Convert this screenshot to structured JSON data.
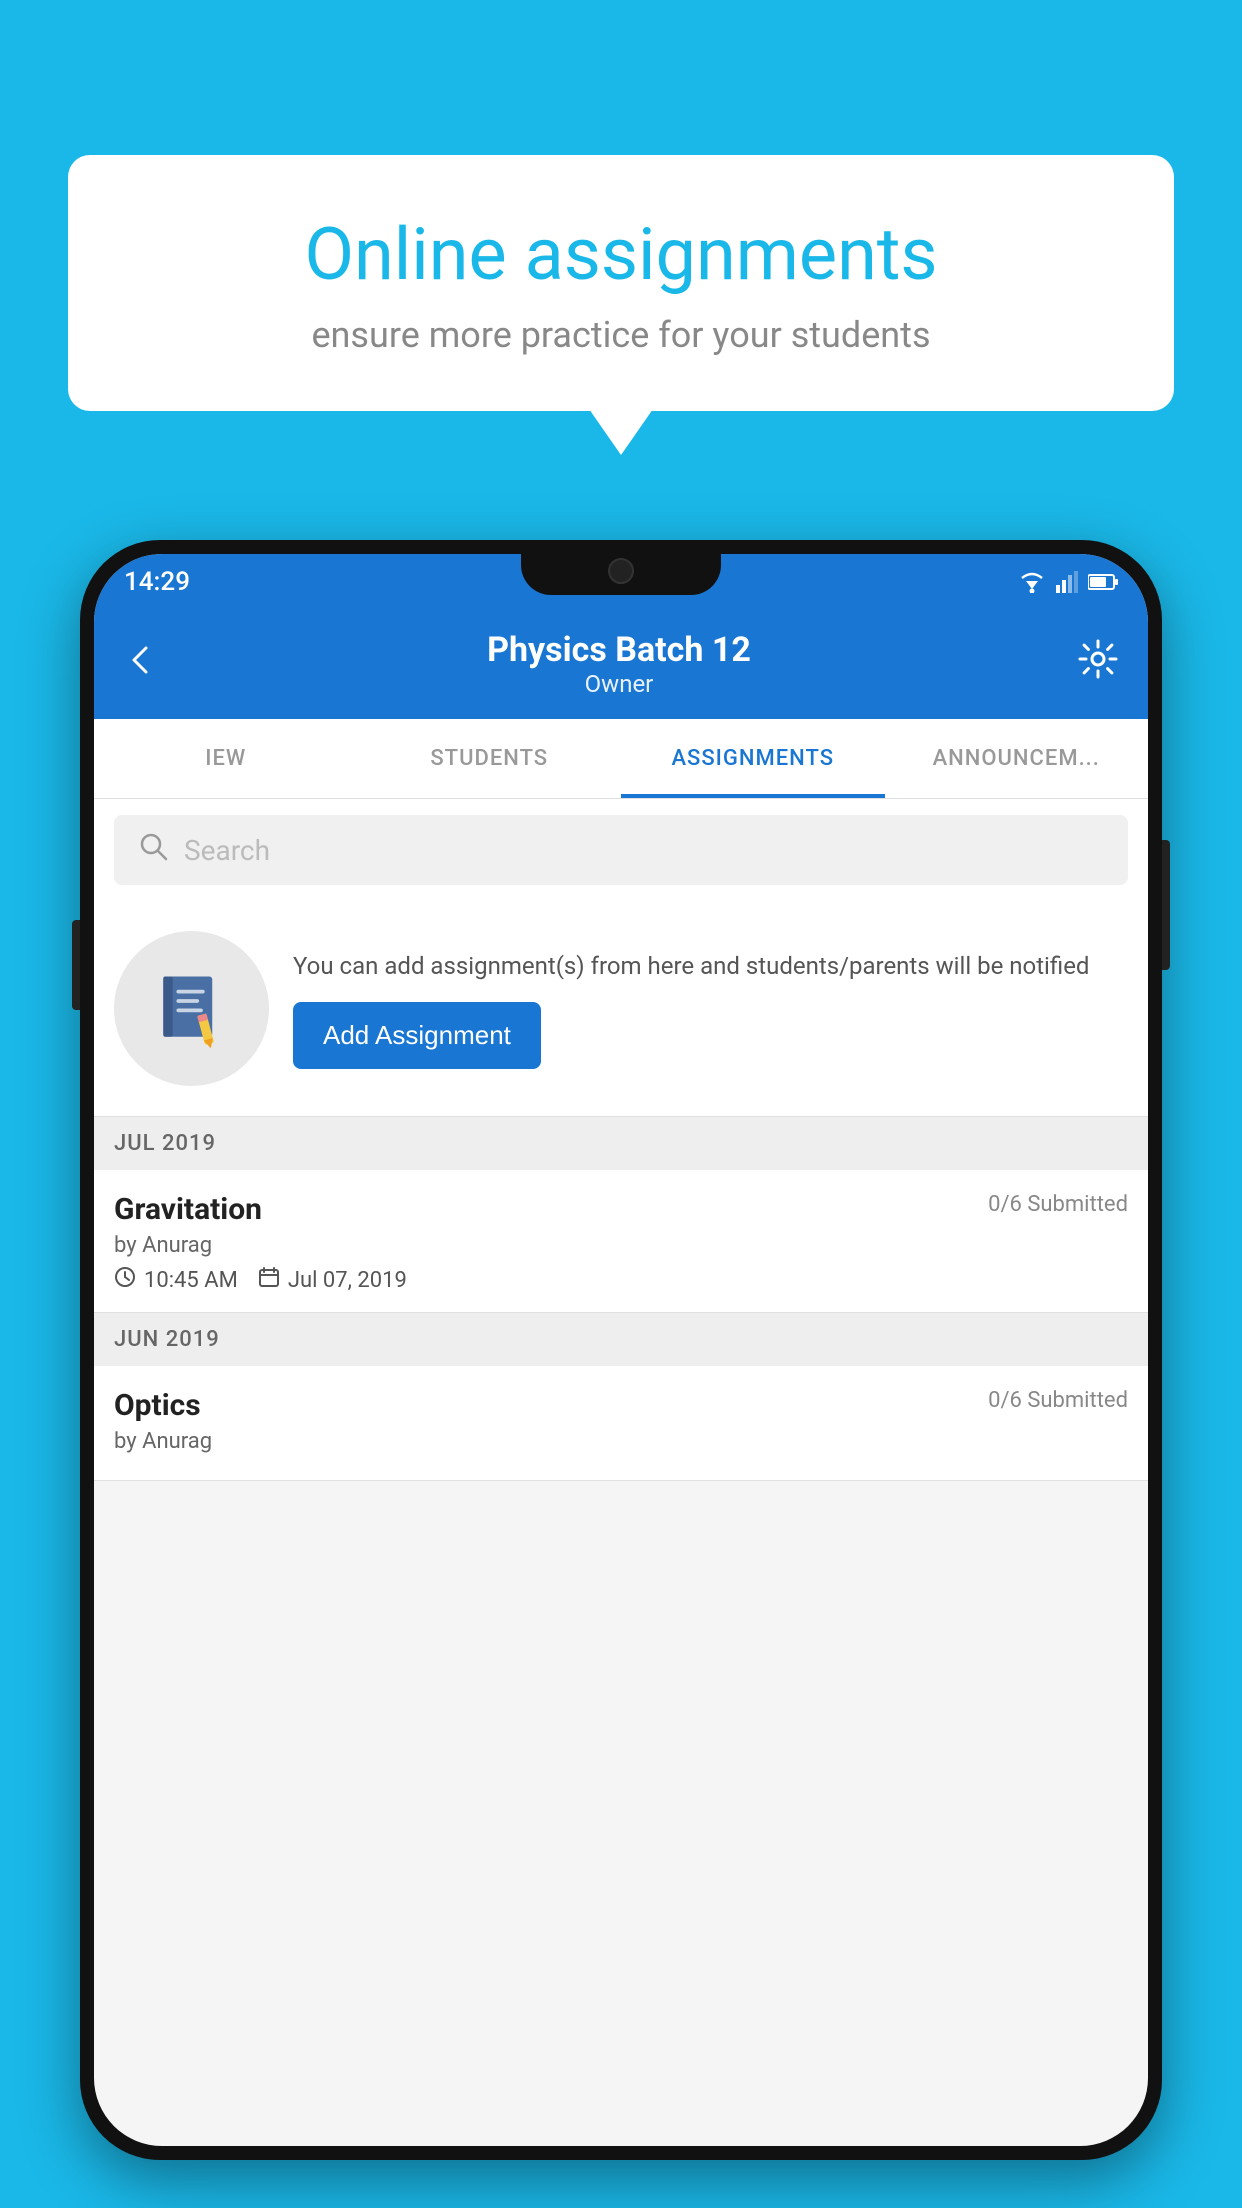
{
  "background_color": "#1ab8e8",
  "speech_bubble": {
    "title": "Online assignments",
    "subtitle": "ensure more practice for your students"
  },
  "status_bar": {
    "time": "14:29"
  },
  "app_bar": {
    "title": "Physics Batch 12",
    "subtitle": "Owner"
  },
  "tabs": [
    {
      "label": "IEW",
      "active": false
    },
    {
      "label": "STUDENTS",
      "active": false
    },
    {
      "label": "ASSIGNMENTS",
      "active": true
    },
    {
      "label": "ANNOUNCEM...",
      "active": false
    }
  ],
  "search": {
    "placeholder": "Search"
  },
  "promo": {
    "description": "You can add assignment(s) from here and students/parents will be notified",
    "button_label": "Add Assignment"
  },
  "sections": [
    {
      "header": "JUL 2019",
      "assignments": [
        {
          "name": "Gravitation",
          "submitted": "0/6 Submitted",
          "by": "by Anurag",
          "time": "10:45 AM",
          "date": "Jul 07, 2019"
        }
      ]
    },
    {
      "header": "JUN 2019",
      "assignments": [
        {
          "name": "Optics",
          "submitted": "0/6 Submitted",
          "by": "by Anurag",
          "time": "",
          "date": ""
        }
      ]
    }
  ]
}
